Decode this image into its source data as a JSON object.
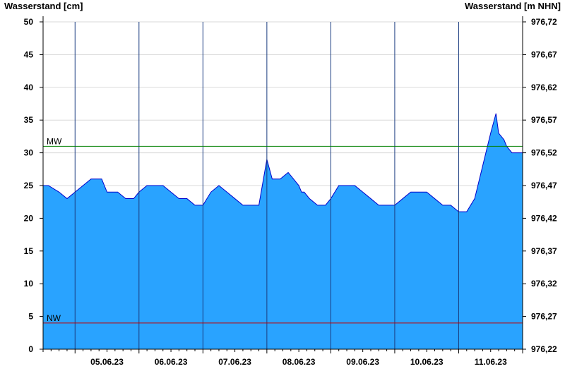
{
  "chart_data": {
    "type": "area",
    "ylabel_left": "Wasserstand [cm]",
    "ylabel_right": "Wasserstand [m NHN]",
    "ylim": [
      0,
      50
    ],
    "ylim_right": [
      976.22,
      976.72
    ],
    "yticks": [
      0,
      5,
      10,
      15,
      20,
      25,
      30,
      35,
      40,
      45,
      50
    ],
    "yticks_right": [
      "976,22",
      "976,27",
      "976,32",
      "976,37",
      "976,42",
      "976,47",
      "976,52",
      "976,57",
      "976,62",
      "976,67",
      "976,72"
    ],
    "xlim_days": [
      "04.06.23 12:00",
      "11.06.23 24:00"
    ],
    "x_tick_labels": [
      "05.06.23",
      "06.06.23",
      "07.06.23",
      "08.06.23",
      "09.06.23",
      "10.06.23",
      "11.06.23"
    ],
    "grid": true,
    "fill_color": "#29a3ff",
    "line_color": "#0000cc",
    "reference_lines": [
      {
        "name": "MW",
        "value": 31,
        "color": "#008000"
      },
      {
        "name": "NW",
        "value": 4,
        "color": "#c00000"
      }
    ],
    "series": [
      {
        "x": [
          "04.06.23 12:00",
          "04.06.23 14:00",
          "04.06.23 18:00",
          "04.06.23 21:00",
          "05.06.23 00:00",
          "05.06.23 03:00",
          "05.06.23 06:00",
          "05.06.23 08:00",
          "05.06.23 10:00",
          "05.06.23 12:00",
          "05.06.23 16:00",
          "05.06.23 19:00",
          "05.06.23 22:00",
          "06.06.23 00:00",
          "06.06.23 03:00",
          "06.06.23 06:00",
          "06.06.23 09:00",
          "06.06.23 12:00",
          "06.06.23 15:00",
          "06.06.23 18:00",
          "06.06.23 21:00",
          "07.06.23 00:00",
          "07.06.23 03:00",
          "07.06.23 06:00",
          "07.06.23 09:00",
          "07.06.23 12:00",
          "07.06.23 15:00",
          "07.06.23 18:00",
          "07.06.23 21:00",
          "08.06.23 00:00",
          "08.06.23 02:00",
          "08.06.23 05:00",
          "08.06.23 08:00",
          "08.06.23 10:00",
          "08.06.23 12:00",
          "08.06.23 13:00",
          "08.06.23 14:00",
          "08.06.23 16:00",
          "08.06.23 19:00",
          "08.06.23 20:00",
          "08.06.23 22:00",
          "09.06.23 00:00",
          "09.06.23 03:00",
          "09.06.23 06:00",
          "09.06.23 09:00",
          "09.06.23 12:00",
          "09.06.23 15:00",
          "09.06.23 18:00",
          "09.06.23 21:00",
          "10.06.23 00:00",
          "10.06.23 03:00",
          "10.06.23 06:00",
          "10.06.23 09:00",
          "10.06.23 12:00",
          "10.06.23 15:00",
          "10.06.23 18:00",
          "10.06.23 21:00",
          "11.06.23 00:00",
          "11.06.23 03:00",
          "11.06.23 06:00",
          "11.06.23 09:00",
          "11.06.23 12:00",
          "11.06.23 14:00",
          "11.06.23 15:00",
          "11.06.23 17:00",
          "11.06.23 18:00",
          "11.06.23 20:00",
          "11.06.23 21:00",
          "11.06.23 23:00",
          "11.06.23 24:00"
        ],
        "y": [
          25,
          25,
          24,
          23,
          24,
          25,
          26,
          26,
          26,
          24,
          24,
          23,
          23,
          24,
          25,
          25,
          25,
          24,
          23,
          23,
          22,
          22,
          24,
          25,
          24,
          23,
          22,
          22,
          22,
          29,
          26,
          26,
          27,
          26,
          25,
          24,
          24,
          23,
          22,
          22,
          22,
          23,
          25,
          25,
          25,
          24,
          23,
          22,
          22,
          22,
          23,
          24,
          24,
          24,
          23,
          22,
          22,
          21,
          21,
          23,
          28,
          33,
          36,
          33,
          32,
          31,
          30,
          30,
          30,
          30
        ]
      }
    ]
  }
}
